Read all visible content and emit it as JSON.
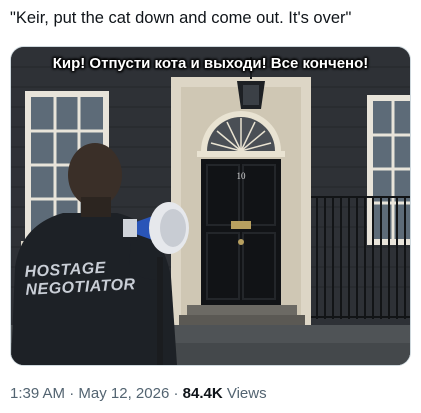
{
  "post": {
    "text": "\"Keir, put the cat down and come out. It's over\""
  },
  "media": {
    "caption": "Кир! Отпусти кота и выходи! Все кончено!",
    "vest_line1": "HOSTAGE",
    "vest_line2": "NEGOTIATOR",
    "door_number": "10"
  },
  "meta": {
    "time": "1:39 AM",
    "separator1": "·",
    "date": "May 12, 2026",
    "separator2": "·",
    "views_count": "84.4K",
    "views_label": "Views"
  }
}
